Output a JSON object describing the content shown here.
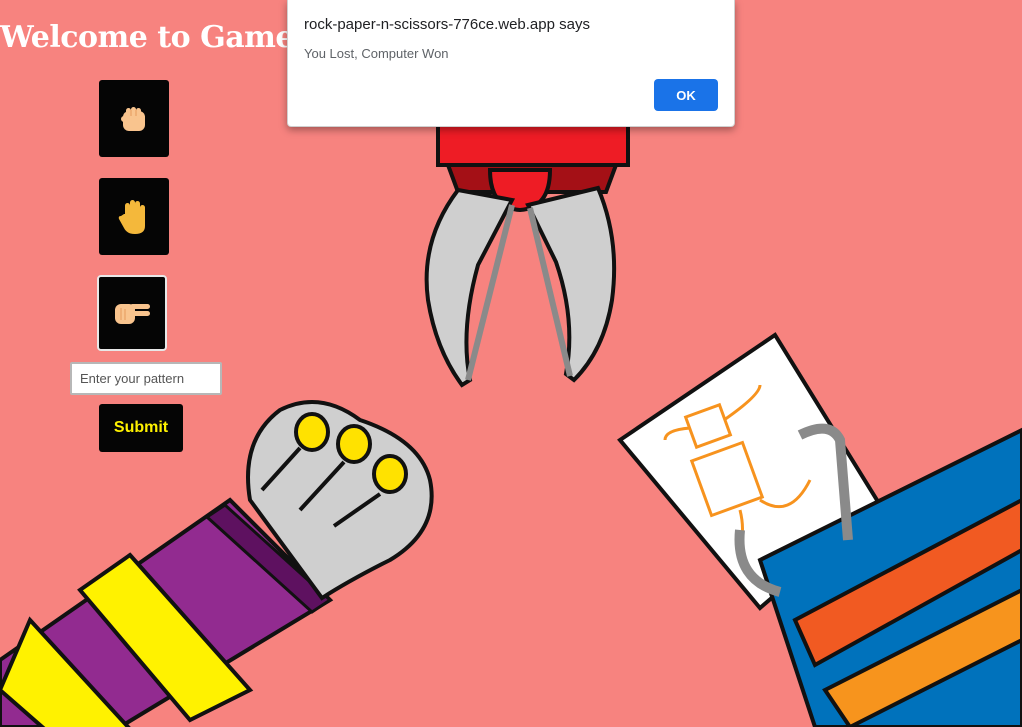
{
  "page": {
    "title": "Welcome to Game P",
    "background_color": "#f7837f"
  },
  "choices": [
    {
      "name": "rock",
      "icon": "fist-icon"
    },
    {
      "name": "paper",
      "icon": "raised-hand-icon"
    },
    {
      "name": "scissors",
      "icon": "victory-hand-icon",
      "selected": true
    }
  ],
  "form": {
    "input_placeholder": "Enter your pattern",
    "input_value": "",
    "submit_label": "Submit",
    "submit_text_color": "#fff200"
  },
  "illustration": {
    "subjects": [
      "robot-scissors-icon",
      "robot-fist-rock-icon",
      "robot-paper-hand-icon"
    ]
  },
  "alert": {
    "origin": "rock-paper-n-scissors-776ce.web.app says",
    "message": "You Lost, Computer Won",
    "ok_label": "OK",
    "ok_color": "#1a73e8"
  }
}
